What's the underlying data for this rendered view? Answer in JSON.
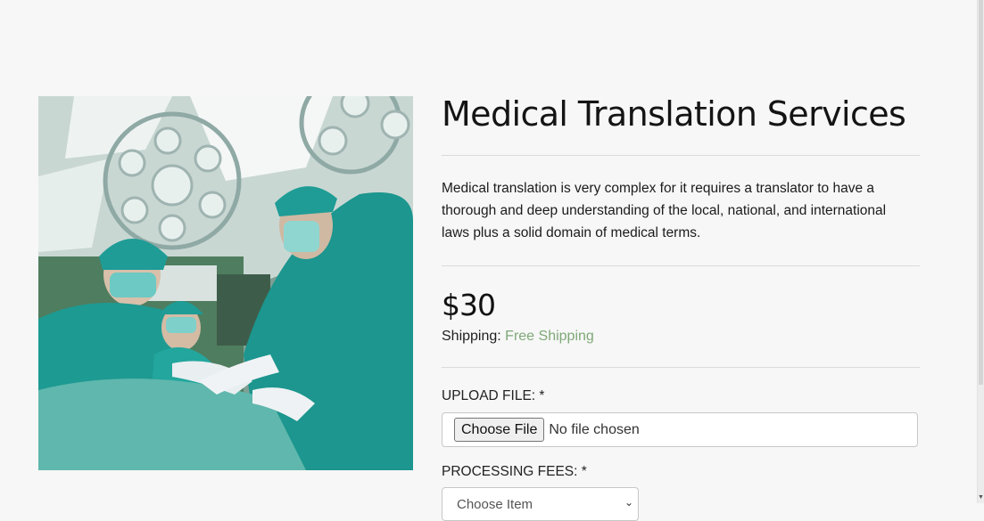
{
  "product": {
    "title": "Medical Translation Services",
    "description": "Medical translation is very complex for it requires a translator to have a thorough and deep understanding of the local, national, and international laws plus a solid domain of medical terms.",
    "price": "$30",
    "shipping_label": "Shipping:",
    "shipping_value": "Free Shipping",
    "image_icon": "surgery-photo"
  },
  "form": {
    "upload_label": "UPLOAD FILE: *",
    "choose_file_label": "Choose File",
    "file_status": "No file chosen",
    "fees_label": "PROCESSING FEES: *",
    "fees_selected": "Choose Item"
  },
  "colors": {
    "background": "#f6f7f6",
    "accent_shipping": "#80a879",
    "scrubs": "#1e9c95"
  }
}
